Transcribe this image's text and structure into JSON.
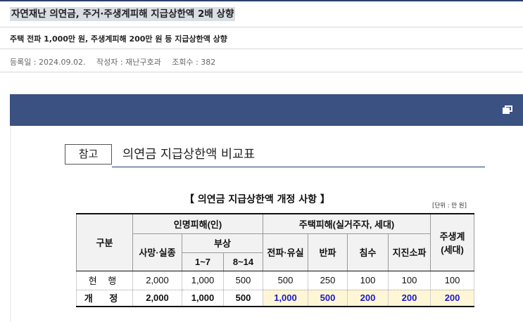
{
  "post": {
    "title": "자연재난 의연금, 주거·주생계피해 지급상한액 2배 상향",
    "subtitle": "주택 전파 1,000만 원, 주생계피해 200만 원 등 지급상한액 상향",
    "meta": {
      "date": "등록일 : 2024.09.02.",
      "author": "작성자 : 재난구호과",
      "views": "조회수 : 382"
    }
  },
  "card": {
    "window_icon": "restore-window-icon",
    "header_color": "#3b5181",
    "ref_label": "참고",
    "ref_title": "의연금 지급상한액 비교표"
  },
  "table": {
    "title": "【 의연금 지급상한액 개정 사항 】",
    "unit": "[단위 : 만 원]",
    "headers": {
      "category": "구분",
      "human": "인명피해(인)",
      "death": "사망·실종",
      "injury": "부상",
      "injury_1": "1~7",
      "injury_2": "8~14",
      "housing": "주택피해(실거주자, 세대)",
      "total_loss": "전파·유실",
      "half_loss": "반파",
      "flooding": "침수",
      "quake": "지진소파",
      "livelihood": "주생계",
      "livelihood_unit": "(세대)"
    },
    "rows": [
      {
        "label": "현 행",
        "values": [
          "2,000",
          "1,000",
          "500",
          "500",
          "250",
          "100",
          "100",
          "100"
        ]
      },
      {
        "label": "개 정",
        "values": [
          "2,000",
          "1,000",
          "500",
          "1,000",
          "500",
          "200",
          "200",
          "200"
        ]
      }
    ],
    "highlight_color": "#fff6d5",
    "highlight_text_color": "#1a1acc"
  }
}
